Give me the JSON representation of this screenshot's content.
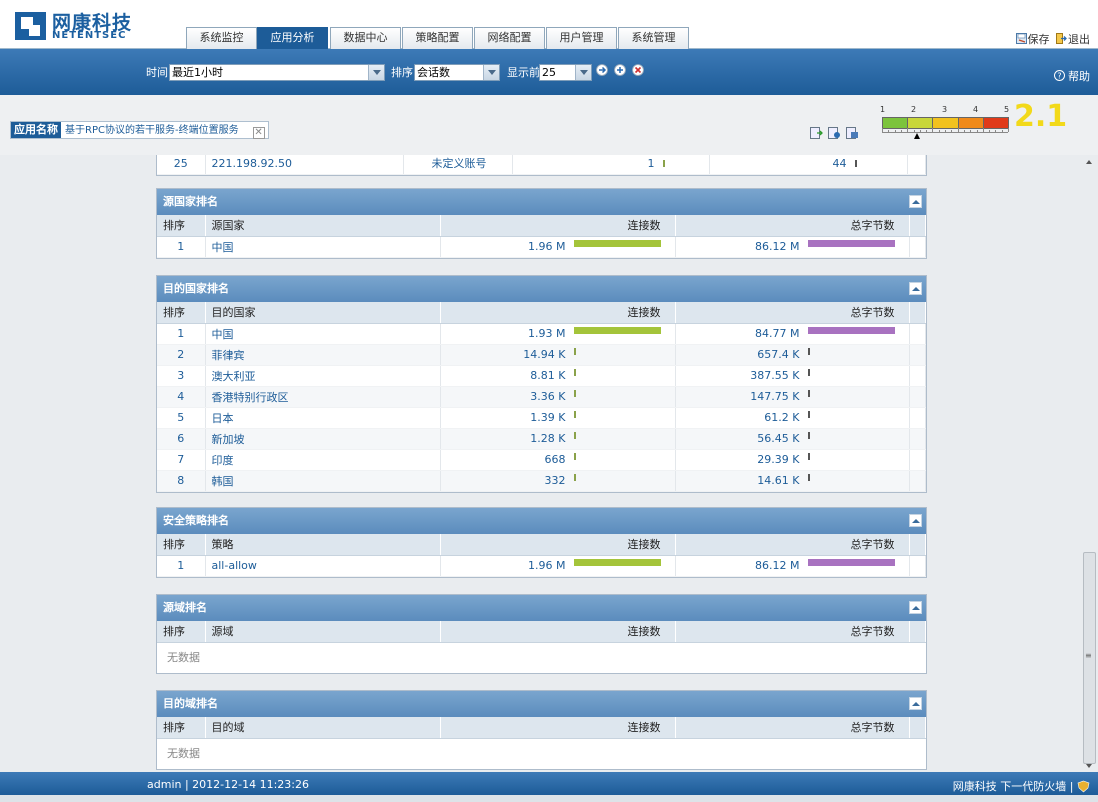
{
  "header": {
    "logo_cn": "网康科技",
    "logo_en": "NETENTSEC",
    "tabs": [
      "系统监控",
      "应用分析",
      "数据中心",
      "策略配置",
      "网络配置",
      "用户管理",
      "系统管理"
    ],
    "active_tab": "应用分析",
    "save_label": "保存",
    "logout_label": "退出"
  },
  "toolbar": {
    "time_label": "时间",
    "time_value": "最近1小时",
    "sort_label": "排序",
    "sort_value": "会话数",
    "show_label": "显示前",
    "show_value": "25",
    "help_label": "帮助"
  },
  "infobar": {
    "app_label": "应用名称",
    "app_value": "基于RPC协议的若干服务-终端位置服务",
    "gauge_ticks": [
      "1",
      "2",
      "3",
      "4",
      "5"
    ],
    "gauge_colors": [
      "#7cc43c",
      "#c8d63a",
      "#f2c21e",
      "#f08a1a",
      "#e03a1a"
    ],
    "score": "2.1",
    "score_fraction": 0.275
  },
  "partial_row": {
    "rank": "25",
    "ip": "221.198.92.50",
    "account": "未定义账号",
    "sessions": "1",
    "bytes": "44"
  },
  "colors": {
    "conn_bar": "#a4c43a",
    "bytes_bar": "#a872c0",
    "tick_bar": "#8aa24a"
  },
  "panels": [
    {
      "title": "源国家排名",
      "headers": [
        "排序",
        "源国家",
        "连接数",
        "总字节数"
      ],
      "rows": [
        {
          "rank": "1",
          "name": "中国",
          "conn": "1.96 M",
          "conn_frac": 1.0,
          "bytes": "86.12 M",
          "bytes_frac": 1.0
        }
      ]
    },
    {
      "title": "目的国家排名",
      "headers": [
        "排序",
        "目的国家",
        "连接数",
        "总字节数"
      ],
      "rows": [
        {
          "rank": "1",
          "name": "中国",
          "conn": "1.93 M",
          "conn_frac": 1.0,
          "bytes": "84.77 M",
          "bytes_frac": 1.0
        },
        {
          "rank": "2",
          "name": "菲律宾",
          "conn": "14.94 K",
          "conn_frac": 0.008,
          "bytes": "657.4 K",
          "bytes_frac": 0.008
        },
        {
          "rank": "3",
          "name": "澳大利亚",
          "conn": "8.81 K",
          "conn_frac": 0.005,
          "bytes": "387.55 K",
          "bytes_frac": 0.005
        },
        {
          "rank": "4",
          "name": "香港特别行政区",
          "conn": "3.36 K",
          "conn_frac": 0.002,
          "bytes": "147.75 K",
          "bytes_frac": 0.002
        },
        {
          "rank": "5",
          "name": "日本",
          "conn": "1.39 K",
          "conn_frac": 0.001,
          "bytes": "61.2 K",
          "bytes_frac": 0.001
        },
        {
          "rank": "6",
          "name": "新加坡",
          "conn": "1.28 K",
          "conn_frac": 0.001,
          "bytes": "56.45 K",
          "bytes_frac": 0.001
        },
        {
          "rank": "7",
          "name": "印度",
          "conn": "668",
          "conn_frac": 0.0,
          "bytes": "29.39 K",
          "bytes_frac": 0.0
        },
        {
          "rank": "8",
          "name": "韩国",
          "conn": "332",
          "conn_frac": 0.0,
          "bytes": "14.61 K",
          "bytes_frac": 0.0
        }
      ]
    },
    {
      "title": "安全策略排名",
      "headers": [
        "排序",
        "策略",
        "连接数",
        "总字节数"
      ],
      "rows": [
        {
          "rank": "1",
          "name": "all-allow",
          "conn": "1.96 M",
          "conn_frac": 1.0,
          "bytes": "86.12 M",
          "bytes_frac": 1.0
        }
      ]
    },
    {
      "title": "源域排名",
      "headers": [
        "排序",
        "源域",
        "连接数",
        "总字节数"
      ],
      "rows": [],
      "nodata": "无数据"
    },
    {
      "title": "目的域排名",
      "headers": [
        "排序",
        "目的域",
        "连接数",
        "总字节数"
      ],
      "rows": [],
      "nodata": "无数据"
    }
  ],
  "footer": {
    "user_info": "admin | 2012-12-14 11:23:26",
    "brand": "网康科技 下一代防火墙 |"
  }
}
